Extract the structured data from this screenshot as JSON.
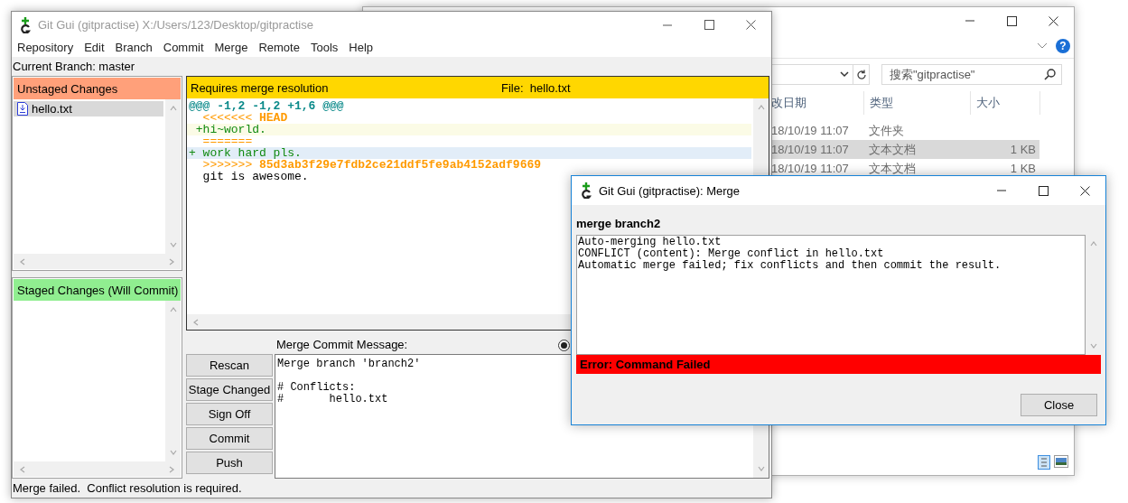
{
  "explorer": {
    "search": {
      "placeholder": "搜索\"gitpractise\""
    },
    "columns": [
      "改日期",
      "类型",
      "大小"
    ],
    "rows": [
      {
        "date": "18/10/19 11:07",
        "type": "文件夹",
        "size": "",
        "selected": false
      },
      {
        "date": "18/10/19 11:07",
        "type": "文本文档",
        "size": "1 KB",
        "selected": true
      },
      {
        "date": "18/10/19 11:07",
        "type": "文本文档",
        "size": "1 KB",
        "selected": false
      }
    ],
    "help": "?"
  },
  "git_gui": {
    "window": {
      "title": "Git Gui (gitpractise) X:/Users/123/Desktop/gitpractise"
    },
    "menu": [
      "Repository",
      "Edit",
      "Branch",
      "Commit",
      "Merge",
      "Remote",
      "Tools",
      "Help"
    ],
    "current_branch": "Current Branch: master",
    "unstaged": {
      "title": "Unstaged Changes",
      "files": [
        {
          "name": "hello.txt",
          "selected": true
        }
      ]
    },
    "staged": {
      "title": "Staged Changes (Will Commit)"
    },
    "diff": {
      "status": "Requires merge resolution",
      "file": "File:  hello.txt",
      "lines": [
        {
          "kind": "hunk",
          "text": "@@@ -1,2 -1,2 +1,6 @@@"
        },
        {
          "kind": "marker",
          "text": "  <<<<<<< **HEAD**"
        },
        {
          "kind": "ours",
          "text": " +hi~world."
        },
        {
          "kind": "marker",
          "text": "  ======="
        },
        {
          "kind": "theirs",
          "text": "+ work hard pls."
        },
        {
          "kind": "marker",
          "text": "  >>>>>>> **85d3ab3f29e7fdb2ce21ddf5fe9ab4152adf9669**"
        },
        {
          "kind": "context",
          "text": "  git is awesome."
        }
      ]
    },
    "commit": {
      "label": "Merge Commit Message:",
      "mode": [
        {
          "selected": true
        }
      ],
      "message": "Merge branch 'branch2'\n\n# Conflicts:\n#\thello.txt"
    },
    "buttons": [
      "Rescan",
      "Stage Changed",
      "Sign Off",
      "Commit",
      "Push"
    ],
    "status_bar": "Merge failed.  Conflict resolution is required."
  },
  "merge_dialog": {
    "title": "Git Gui (gitpractise): Merge",
    "heading": "merge branch2",
    "output": [
      "Auto-merging hello.txt",
      "CONFLICT (content): Merge conflict in hello.txt",
      "Automatic merge failed; fix conflicts and then commit the result."
    ],
    "error": "Error: Command Failed",
    "buttons": [
      "Close"
    ]
  }
}
